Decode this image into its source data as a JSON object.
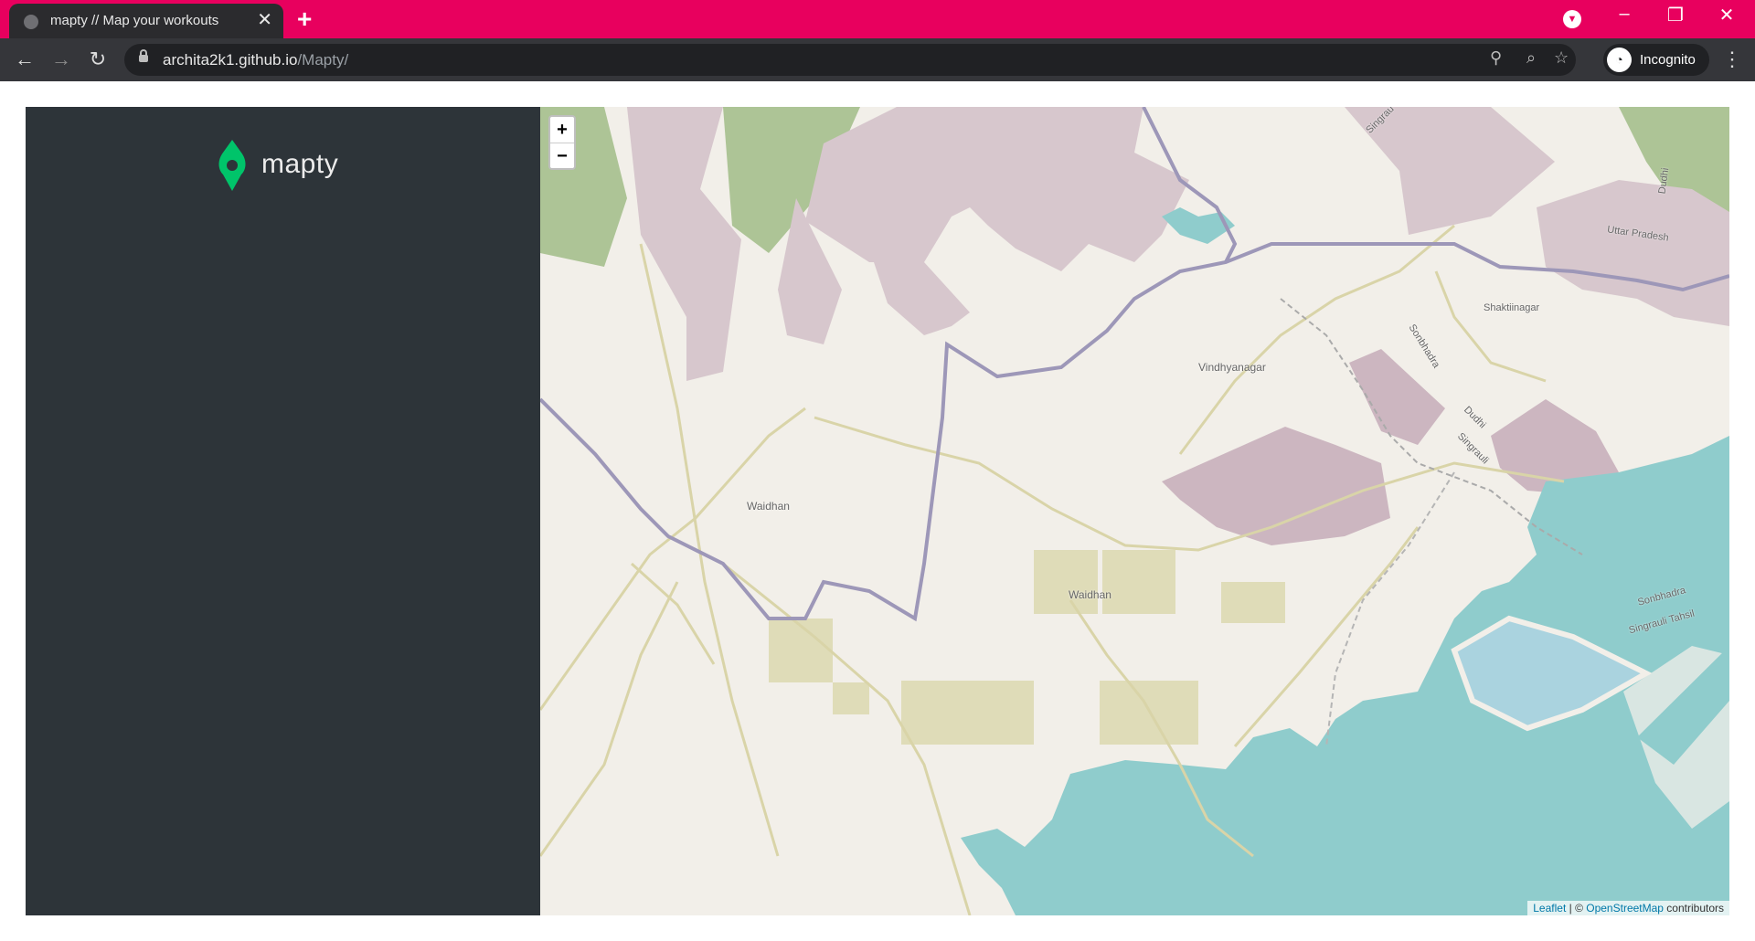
{
  "browser": {
    "tab_title": "mapty // Map your workouts",
    "url_host": "archita2k1.github.io",
    "url_path": "/Mapty/",
    "incognito_label": "Incognito",
    "colors": {
      "tab_strip": "#e8005e",
      "toolbar": "#35363a"
    }
  },
  "app": {
    "logo_text": "mapty",
    "brand_color": "#00c46a",
    "sidebar_color": "#2d3439"
  },
  "map": {
    "zoom_in": "+",
    "zoom_out": "−",
    "attribution": {
      "leaflet": "Leaflet",
      "separator": " | © ",
      "osm": "OpenStreetMap",
      "suffix": " contributors"
    },
    "labels": {
      "vindhyanagar": "Vindhyanagar",
      "waidhan_1": "Waidhan",
      "waidhan_2": "Waidhan",
      "shaktinagar": "Shaktiinagar",
      "uttar_pradesh": "Uttar Pradesh",
      "dudhi_top": "Dudhi",
      "dudhi_mid": "Dudhi",
      "singrauli": "Singrauli",
      "sonbhadra_road": "Sonbhadra",
      "sonbhadra": "Sonbhadra",
      "singrauli_tahsil": "Singrauli Tahsil",
      "singrauli_top": "Singrau"
    }
  }
}
